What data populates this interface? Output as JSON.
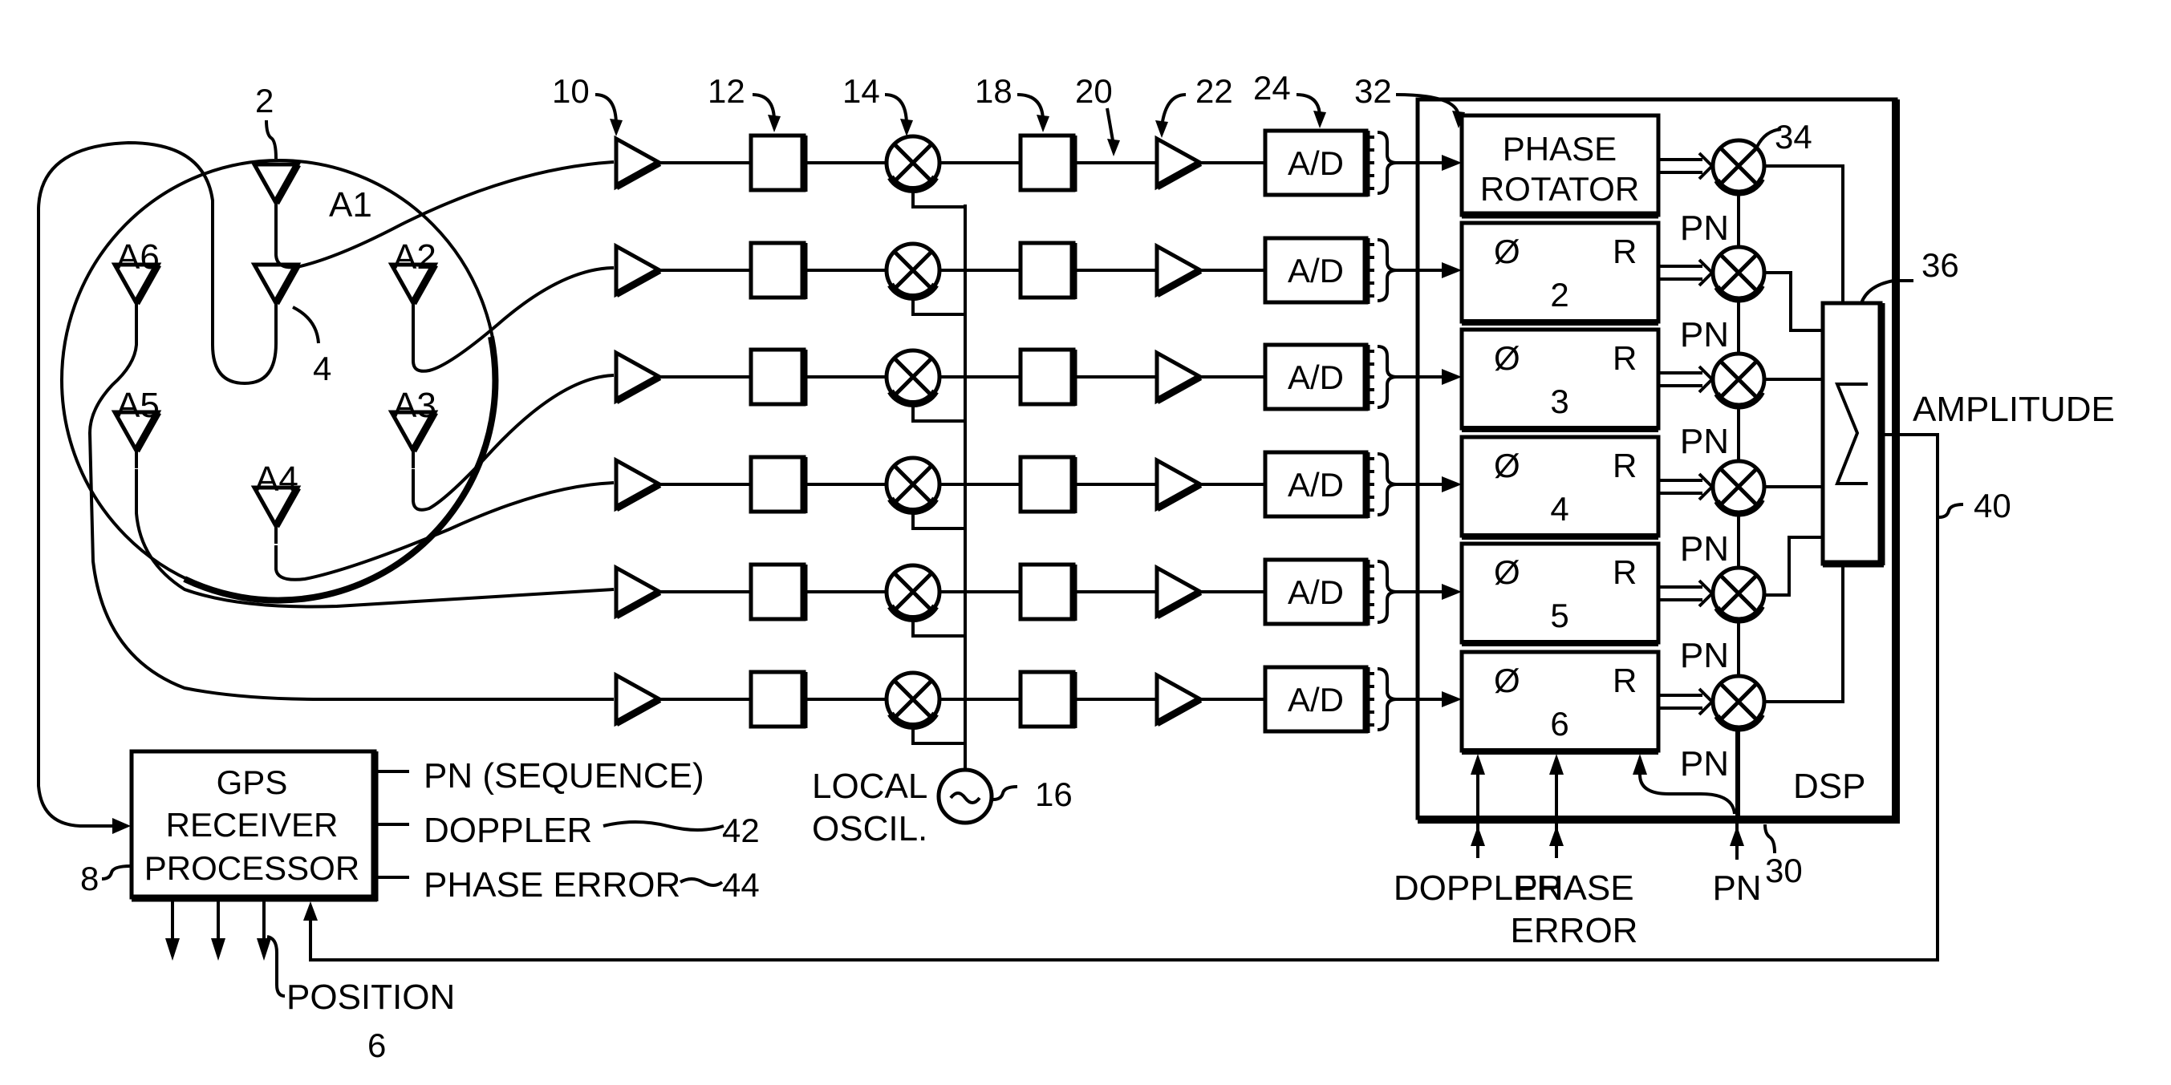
{
  "figure": {
    "antenna_array": {
      "ref": "2",
      "center_element_ref": "4",
      "elements": [
        "A1",
        "A2",
        "A3",
        "A4",
        "A5",
        "A6"
      ]
    },
    "chain_refs": {
      "preamp": "10",
      "filter1": "12",
      "mixer": "14",
      "local_oscillator": "16",
      "filter2": "18",
      "if_line": "20",
      "if_amp": "22",
      "adc": "24",
      "phase_rotator_ref": "32",
      "correlator_ref": "34",
      "summer_ref": "36",
      "dsp_ref": "30",
      "amplitude_ref": "40",
      "doppler_ref": "42",
      "phase_error_ref": "44",
      "gps_ref": "8",
      "position_ref": "6"
    },
    "adc_label": "A/D",
    "local_oscillator": {
      "line1": "LOCAL",
      "line2": "OSCIL."
    },
    "phase_rotator": {
      "line1": "PHASE",
      "line2": "ROTATOR"
    },
    "rotator_channels": [
      {
        "phi": "Ø",
        "r": "R",
        "index": "2"
      },
      {
        "phi": "Ø",
        "r": "R",
        "index": "3"
      },
      {
        "phi": "Ø",
        "r": "R",
        "index": "4"
      },
      {
        "phi": "Ø",
        "r": "R",
        "index": "5"
      },
      {
        "phi": "Ø",
        "r": "R",
        "index": "6"
      }
    ],
    "pn_label": "PN",
    "summer_symbol": "Σ",
    "dsp_label": "DSP",
    "amplitude_label": "AMPLITUDE",
    "dsp_inputs": {
      "doppler": "DOPPLER",
      "phase_error_1": "PHASE",
      "phase_error_2": "ERROR",
      "pn": "PN"
    },
    "gps_box": {
      "line1": "GPS",
      "line2": "RECEIVER",
      "line3": "PROCESSOR"
    },
    "gps_outputs": {
      "pn": "PN (SEQUENCE)",
      "doppler": "DOPPLER",
      "phase_error": "PHASE ERROR"
    },
    "position_label": "POSITION"
  }
}
